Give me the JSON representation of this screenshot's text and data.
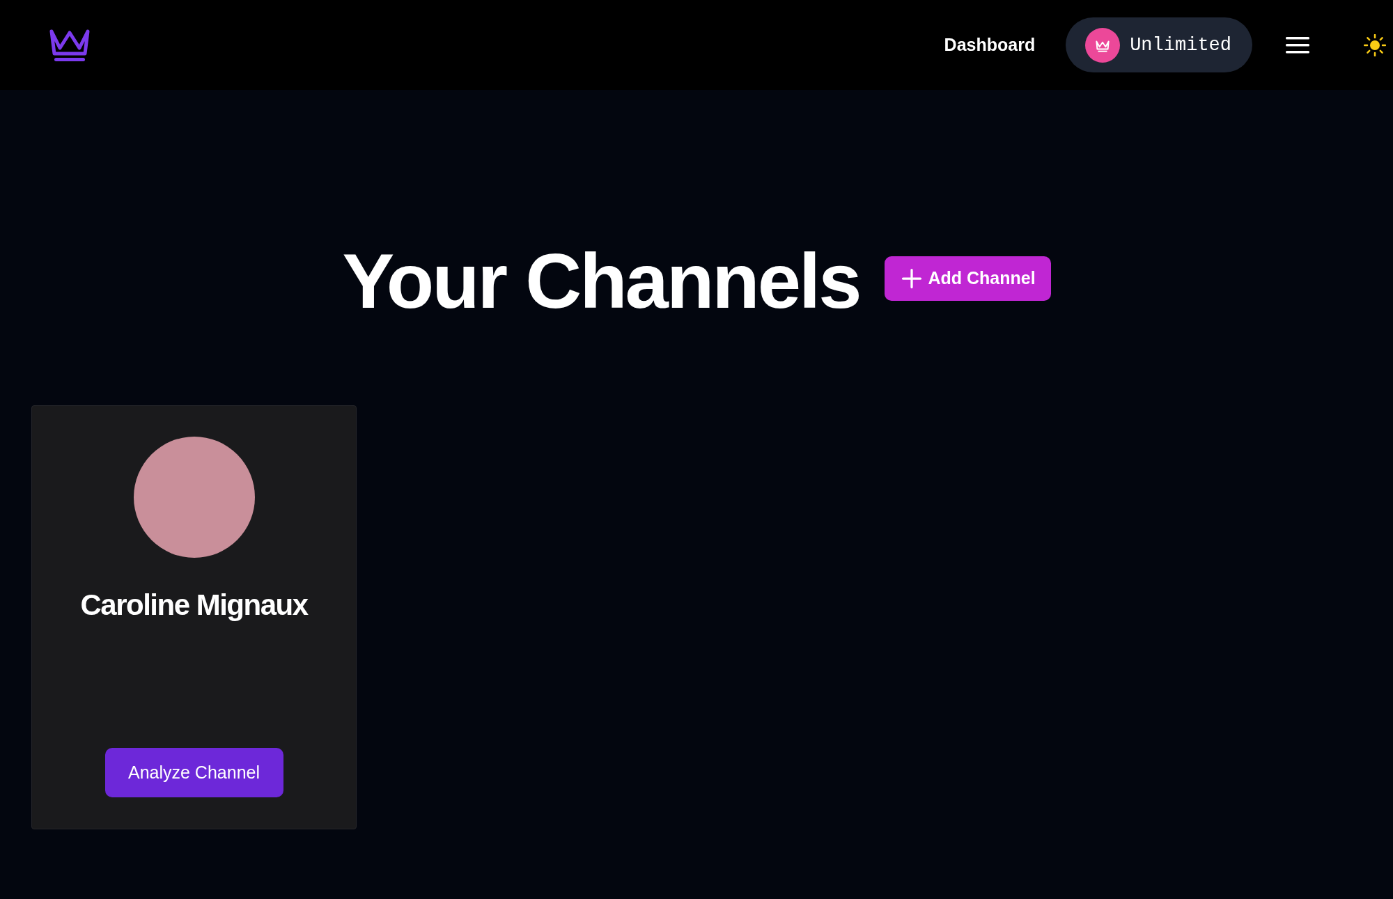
{
  "nav": {
    "links": [
      "Dashboard"
    ],
    "plan": "Unlimited"
  },
  "heading": "Your Channels",
  "add_button": "Add Channel",
  "channels": [
    {
      "name": "Caroline Mignaux",
      "action": "Analyze Channel"
    }
  ]
}
